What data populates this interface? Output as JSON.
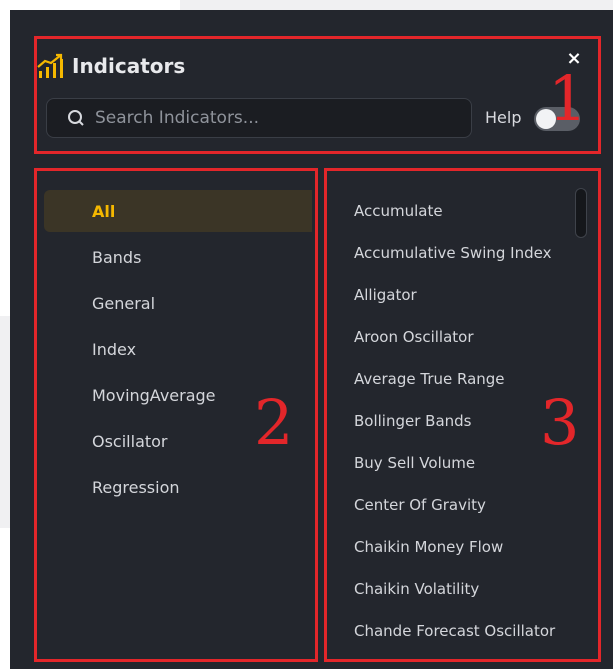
{
  "header": {
    "title": "Indicators",
    "close_label": "×",
    "search_placeholder": "Search Indicators...",
    "help_label": "Help",
    "help_toggle_on": false
  },
  "categories": [
    {
      "label": "All",
      "active": true
    },
    {
      "label": "Bands"
    },
    {
      "label": "General"
    },
    {
      "label": "Index"
    },
    {
      "label": "MovingAverage"
    },
    {
      "label": "Oscillator"
    },
    {
      "label": "Regression"
    }
  ],
  "indicators": [
    {
      "label": "Accumulate"
    },
    {
      "label": "Accumulative Swing Index"
    },
    {
      "label": "Alligator"
    },
    {
      "label": "Aroon Oscillator"
    },
    {
      "label": "Average True Range"
    },
    {
      "label": "Bollinger Bands"
    },
    {
      "label": "Buy Sell Volume"
    },
    {
      "label": "Center Of Gravity"
    },
    {
      "label": "Chaikin Money Flow"
    },
    {
      "label": "Chaikin Volatility"
    },
    {
      "label": "Chande Forecast Oscillator"
    }
  ],
  "annotations": [
    {
      "label": "1"
    },
    {
      "label": "2"
    },
    {
      "label": "3"
    }
  ],
  "colors": {
    "panel": "#23262d",
    "accent": "#f5b800",
    "annotation": "#e3262a"
  },
  "icons": {
    "title": "bar-chart-trend-icon",
    "search": "search-icon",
    "close": "close-icon"
  }
}
